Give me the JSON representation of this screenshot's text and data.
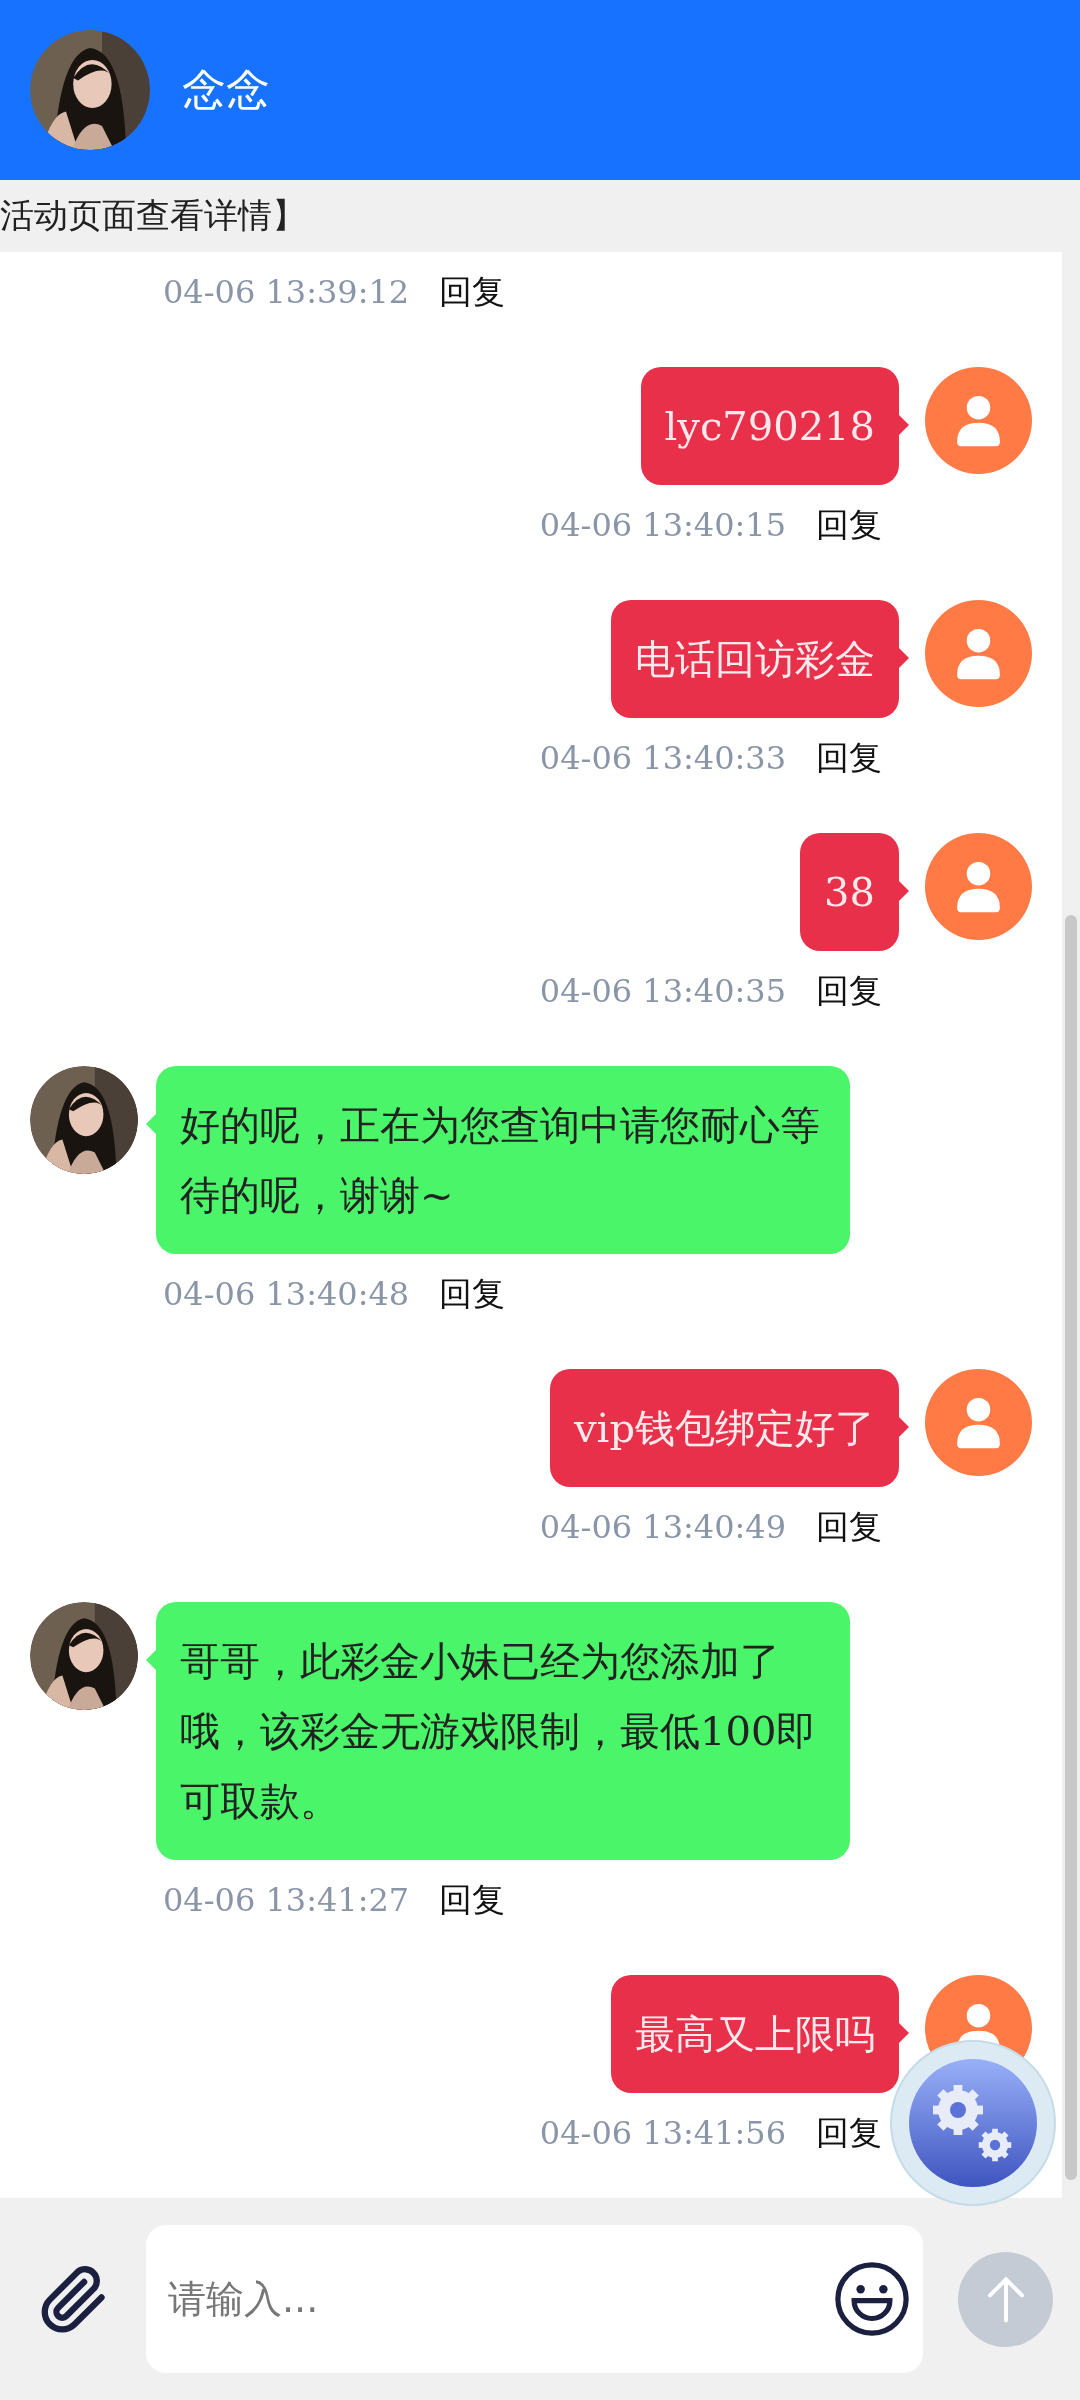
{
  "header": {
    "name": "念念"
  },
  "notice": "活动页面查看详情】",
  "messages": [
    {
      "kind": "agent",
      "time": "04-06 13:39:12",
      "reply": "回复"
    },
    {
      "kind": "user",
      "text": "lyc790218",
      "time": "04-06 13:40:15",
      "reply": "回复"
    },
    {
      "kind": "user",
      "text": "电话回访彩金",
      "time": "04-06 13:40:33",
      "reply": "回复"
    },
    {
      "kind": "user",
      "text": "38",
      "time": "04-06 13:40:35",
      "reply": "回复"
    },
    {
      "kind": "agent",
      "text": "好的呢，正在为您查询中请您耐心等待的呢，谢谢~",
      "time": "04-06 13:40:48",
      "reply": "回复"
    },
    {
      "kind": "user",
      "text": "vip钱包绑定好了",
      "time": "04-06 13:40:49",
      "reply": "回复"
    },
    {
      "kind": "agent",
      "text": "哥哥，此彩金小妹已经为您添加了哦，该彩金无游戏限制，最低100即可取款。",
      "time": "04-06 13:41:27",
      "reply": "回复"
    },
    {
      "kind": "user",
      "text": "最高又上限吗",
      "time": "04-06 13:41:56",
      "reply": "回复"
    }
  ],
  "composer": {
    "placeholder": "请输入..."
  }
}
